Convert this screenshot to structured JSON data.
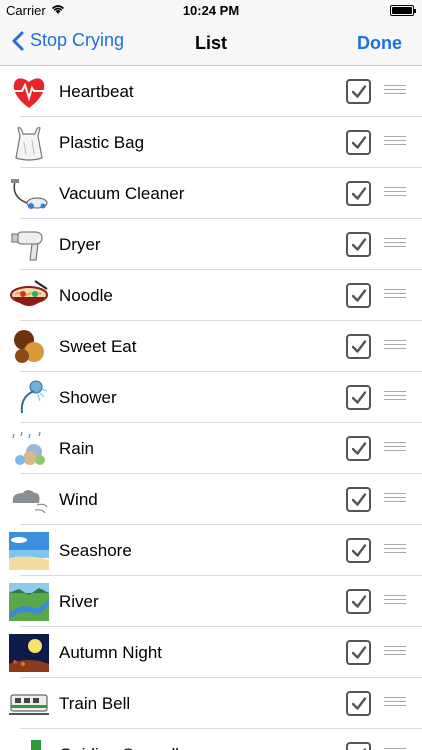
{
  "status_bar": {
    "carrier": "Carrier",
    "time": "10:24 PM"
  },
  "nav": {
    "back_label": "Stop Crying",
    "title": "List",
    "done_label": "Done"
  },
  "colors": {
    "accent": "#1e6fd9",
    "checkbox_border": "#555555"
  },
  "items": [
    {
      "label": "Heartbeat",
      "icon": "heart-icon",
      "checked": true
    },
    {
      "label": "Plastic Bag",
      "icon": "plastic-bag-icon",
      "checked": true
    },
    {
      "label": "Vacuum Cleaner",
      "icon": "vacuum-cleaner-icon",
      "checked": true
    },
    {
      "label": "Dryer",
      "icon": "hair-dryer-icon",
      "checked": true
    },
    {
      "label": "Noodle",
      "icon": "noodle-bowl-icon",
      "checked": true
    },
    {
      "label": "Sweet Eat",
      "icon": "sweets-icon",
      "checked": true
    },
    {
      "label": "Shower",
      "icon": "shower-icon",
      "checked": true
    },
    {
      "label": "Rain",
      "icon": "rain-icon",
      "checked": true
    },
    {
      "label": "Wind",
      "icon": "wind-icon",
      "checked": true
    },
    {
      "label": "Seashore",
      "icon": "seashore-icon",
      "checked": true
    },
    {
      "label": "River",
      "icon": "river-icon",
      "checked": true
    },
    {
      "label": "Autumn Night",
      "icon": "autumn-night-icon",
      "checked": true
    },
    {
      "label": "Train Bell",
      "icon": "train-icon",
      "checked": true
    },
    {
      "label": "Guiding Seagull",
      "icon": "seagull-icon",
      "checked": true
    }
  ]
}
